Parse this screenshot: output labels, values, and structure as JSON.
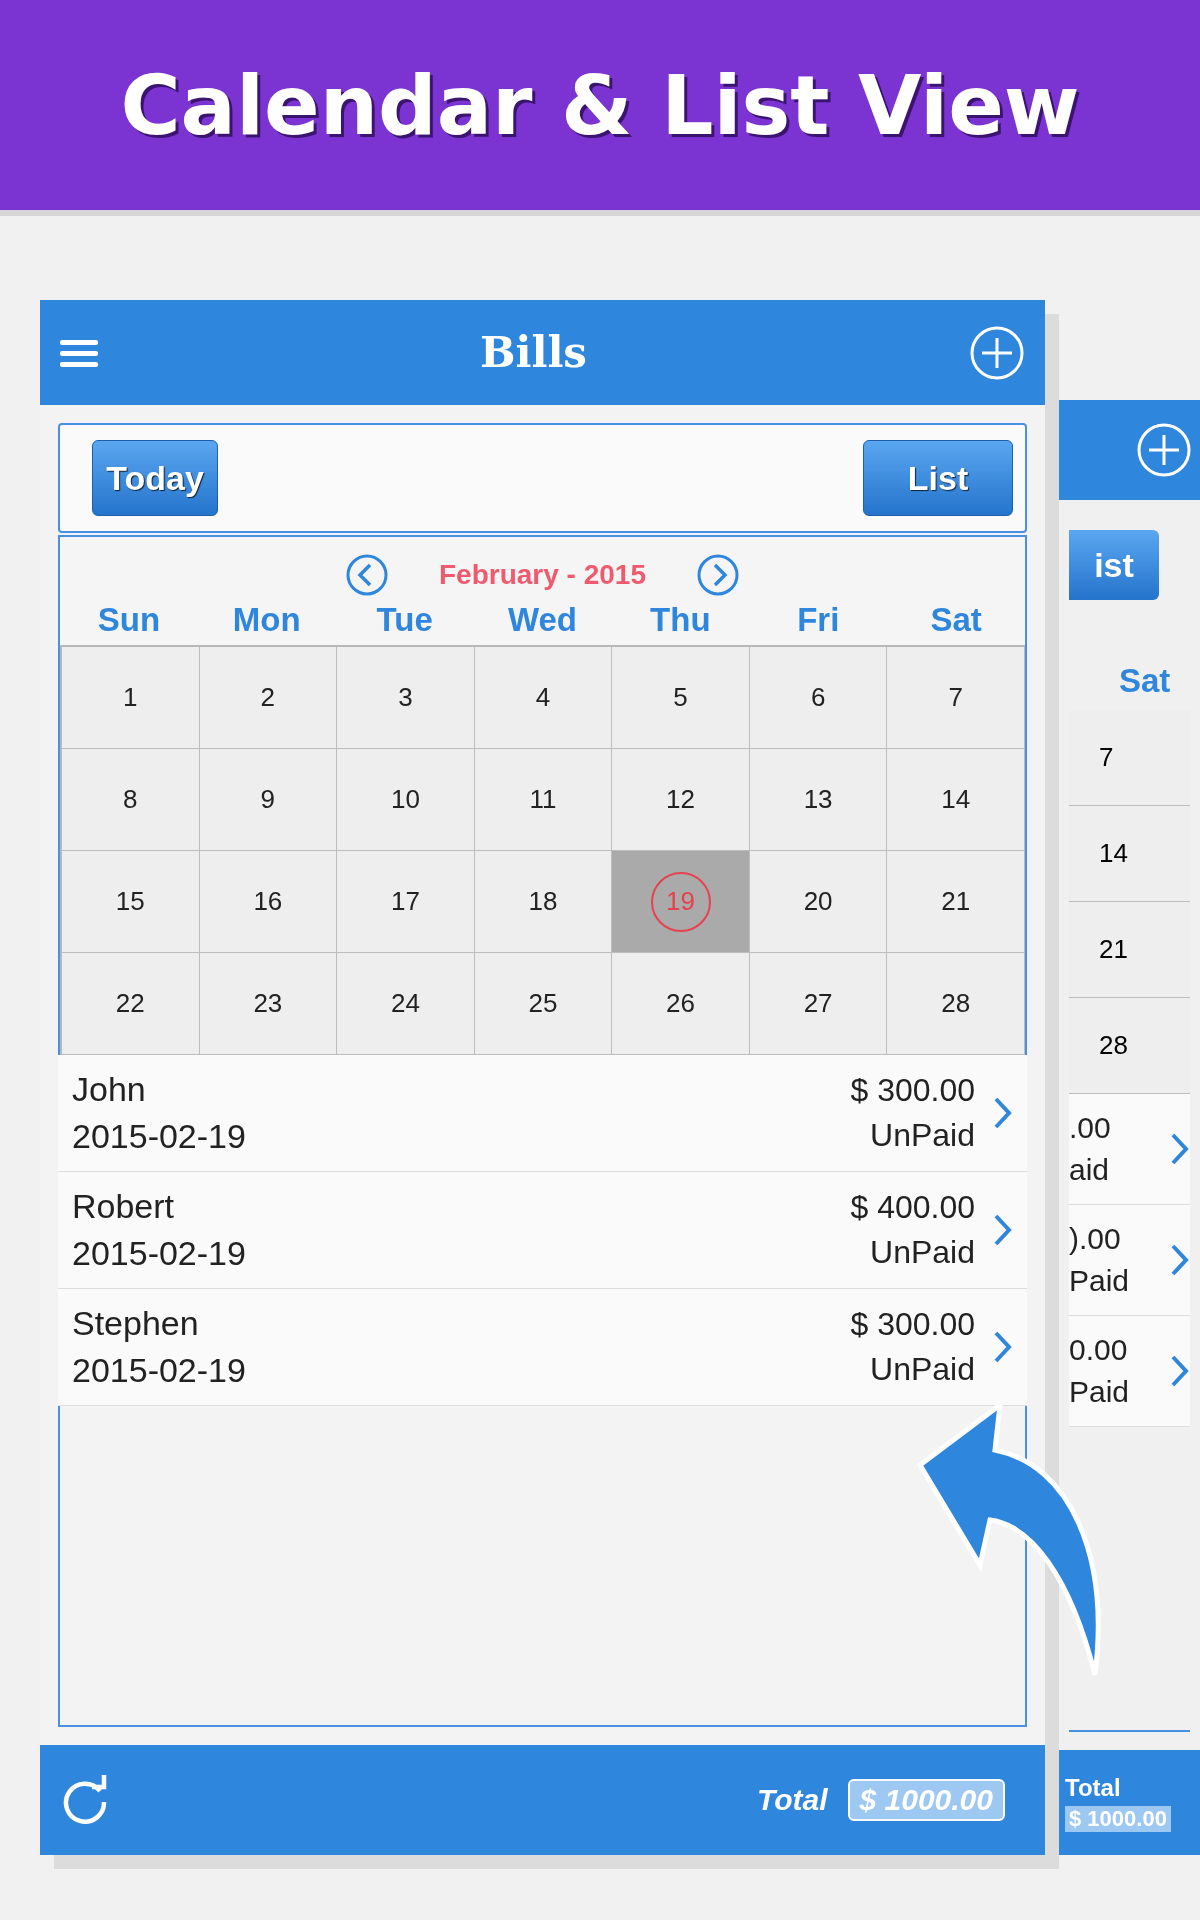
{
  "banner": {
    "title": "Calendar & List View"
  },
  "app": {
    "title": "Bills",
    "today_button": "Today",
    "list_button": "List",
    "month": "February - 2015",
    "weekdays": [
      "Sun",
      "Mon",
      "Tue",
      "Wed",
      "Thu",
      "Fri",
      "Sat"
    ],
    "days": [
      {
        "label": "1",
        "selected": false
      },
      {
        "label": "2",
        "selected": false
      },
      {
        "label": "3",
        "selected": false
      },
      {
        "label": "4",
        "selected": false
      },
      {
        "label": "5",
        "selected": false
      },
      {
        "label": "6",
        "selected": false
      },
      {
        "label": "7",
        "selected": false
      },
      {
        "label": "8",
        "selected": false
      },
      {
        "label": "9",
        "selected": false
      },
      {
        "label": "10",
        "selected": false
      },
      {
        "label": "11",
        "selected": false
      },
      {
        "label": "12",
        "selected": false
      },
      {
        "label": "13",
        "selected": false
      },
      {
        "label": "14",
        "selected": false
      },
      {
        "label": "15",
        "selected": false
      },
      {
        "label": "16",
        "selected": false
      },
      {
        "label": "17",
        "selected": false
      },
      {
        "label": "18",
        "selected": false
      },
      {
        "label": "19",
        "selected": true
      },
      {
        "label": "20",
        "selected": false
      },
      {
        "label": "21",
        "selected": false
      },
      {
        "label": "22",
        "selected": false
      },
      {
        "label": "23",
        "selected": false
      },
      {
        "label": "24",
        "selected": false
      },
      {
        "label": "25",
        "selected": false
      },
      {
        "label": "26",
        "selected": false
      },
      {
        "label": "27",
        "selected": false
      },
      {
        "label": "28",
        "selected": false
      }
    ],
    "bills": [
      {
        "name": "John",
        "date": "2015-02-19",
        "amount": "$ 300.00",
        "status": "UnPaid"
      },
      {
        "name": "Robert",
        "date": "2015-02-19",
        "amount": "$ 400.00",
        "status": "UnPaid"
      },
      {
        "name": "Stephen",
        "date": "2015-02-19",
        "amount": "$ 300.00",
        "status": "UnPaid"
      }
    ],
    "total_label": "Total",
    "total": "$ 1000.00"
  },
  "back_screen": {
    "button": "ist",
    "weekday": "Sat",
    "days": [
      "7",
      "14",
      "21",
      "28"
    ],
    "rows": [
      {
        "amount": ".00",
        "status": "aid"
      },
      {
        "amount": ").00",
        "status": "Paid"
      },
      {
        "amount": "0.00",
        "status": "Paid"
      }
    ],
    "total_label": "Total",
    "total": "$ 1000.00"
  }
}
